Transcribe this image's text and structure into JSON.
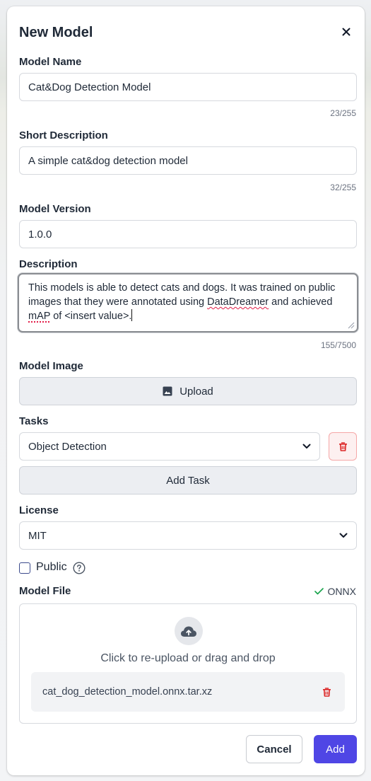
{
  "modal": {
    "title": "New Model"
  },
  "model_name": {
    "label": "Model Name",
    "value": "Cat&Dog Detection Model",
    "counter": "23/255"
  },
  "short_description": {
    "label": "Short Description",
    "value": "A simple cat&dog detection model",
    "counter": "32/255"
  },
  "model_version": {
    "label": "Model Version",
    "value": "1.0.0"
  },
  "description": {
    "label": "Description",
    "text_part1": "This models is able to detect cats and dogs. It was trained on public images that they were annotated using ",
    "text_word1": "DataDreamer",
    "text_part2": " and achieved ",
    "text_word2": "mAP",
    "text_part3": " of <insert value>.",
    "counter": "155/7500"
  },
  "model_image": {
    "label": "Model Image",
    "upload_label": "Upload"
  },
  "tasks": {
    "label": "Tasks",
    "selected": "Object Detection",
    "add_task_label": "Add Task"
  },
  "license": {
    "label": "License",
    "selected": "MIT"
  },
  "public": {
    "label": "Public",
    "checked": false
  },
  "model_file": {
    "label": "Model File",
    "format_badge": "ONNX",
    "dropzone_text": "Click to re-upload or drag and drop",
    "file_name": "cat_dog_detection_model.onnx.tar.xz"
  },
  "footer": {
    "cancel_label": "Cancel",
    "add_label": "Add"
  },
  "colors": {
    "primary": "#4f46e5",
    "danger": "#dc2626",
    "success": "#16a34a"
  },
  "icons": [
    "close-icon",
    "image-icon",
    "chevron-down-icon",
    "trash-icon",
    "help-icon",
    "check-icon",
    "cloud-upload-icon"
  ]
}
